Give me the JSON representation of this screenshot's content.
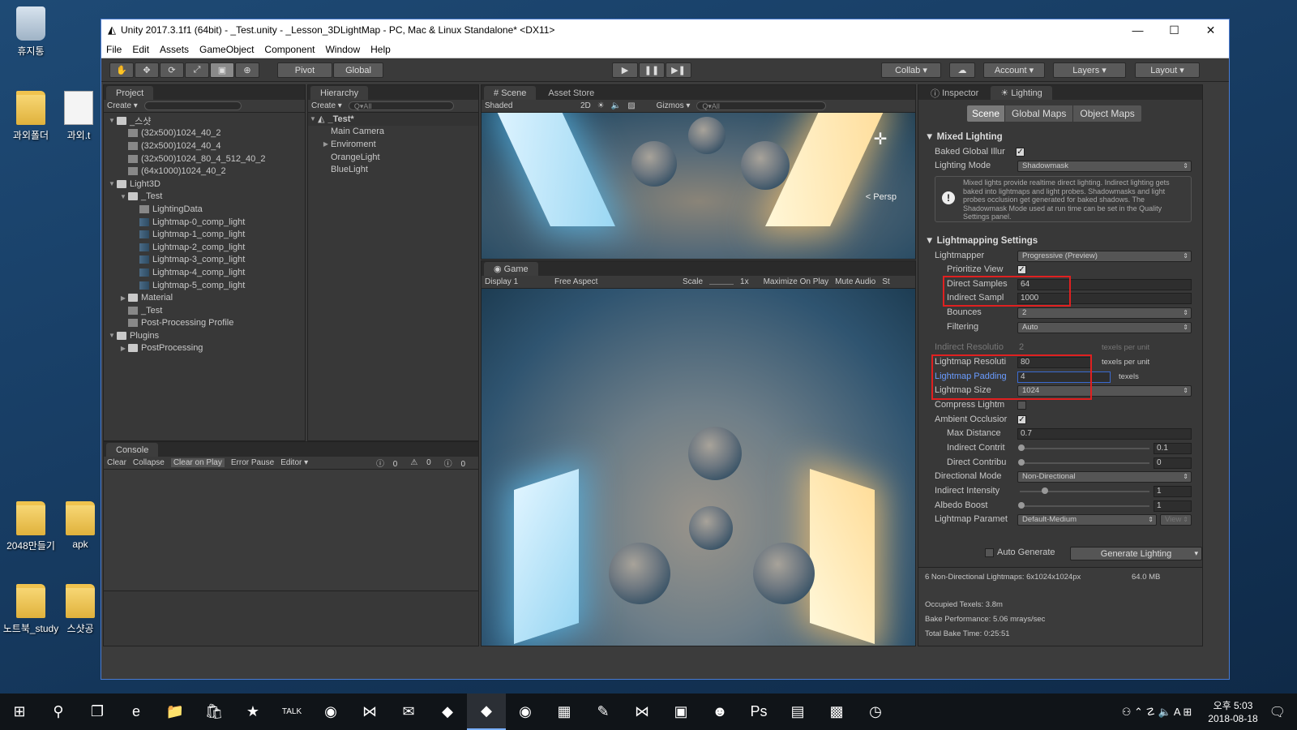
{
  "desktop": {
    "icons": [
      {
        "label": "휴지통",
        "kind": "bin"
      },
      {
        "label": "과외폴더",
        "kind": "folder"
      },
      {
        "label": "과외.t",
        "kind": "doc"
      },
      {
        "label": "2048만들기",
        "kind": "folder"
      },
      {
        "label": "apk",
        "kind": "folder"
      },
      {
        "label": "노트북_study",
        "kind": "folder"
      },
      {
        "label": "스샷공",
        "kind": "folder"
      }
    ]
  },
  "window": {
    "title": "Unity 2017.3.1f1 (64bit) - _Test.unity - _Lesson_3DLightMap - PC, Mac & Linux Standalone* <DX11>",
    "controls": {
      "minimize": "—",
      "maximize": "☐",
      "close": "✕"
    }
  },
  "menu": [
    "File",
    "Edit",
    "Assets",
    "GameObject",
    "Component",
    "Window",
    "Help"
  ],
  "toolbar": {
    "tools": [
      "✋",
      "✥",
      "⟳",
      "⤢",
      "▣",
      "⊕"
    ],
    "pivot": "Pivot",
    "global": "Global",
    "play": "▶",
    "pause": "❚❚",
    "step": "▶❚",
    "collab": "Collab ▾",
    "cloud": "☁",
    "account": "Account",
    "layers": "Layers",
    "layout": "Layout"
  },
  "project": {
    "tab": "Project",
    "create": "Create ▾",
    "items": [
      {
        "label": "_스샷",
        "indent": 0,
        "tri": "▼",
        "icon": "fold"
      },
      {
        "label": "(32x500)1024_40_2",
        "indent": 1,
        "tri": "",
        "icon": "asset"
      },
      {
        "label": "(32x500)1024_40_4",
        "indent": 1,
        "tri": "",
        "icon": "asset"
      },
      {
        "label": "(32x500)1024_80_4_512_40_2",
        "indent": 1,
        "tri": "",
        "icon": "asset"
      },
      {
        "label": "(64x1000)1024_40_2",
        "indent": 1,
        "tri": "",
        "icon": "asset"
      },
      {
        "label": "Light3D",
        "indent": 0,
        "tri": "▼",
        "icon": "fold"
      },
      {
        "label": "_Test",
        "indent": 1,
        "tri": "▼",
        "icon": "fold"
      },
      {
        "label": "LightingData",
        "indent": 2,
        "tri": "",
        "icon": "asset"
      },
      {
        "label": "Lightmap-0_comp_light",
        "indent": 2,
        "tri": "",
        "icon": "lm"
      },
      {
        "label": "Lightmap-1_comp_light",
        "indent": 2,
        "tri": "",
        "icon": "lm"
      },
      {
        "label": "Lightmap-2_comp_light",
        "indent": 2,
        "tri": "",
        "icon": "lm"
      },
      {
        "label": "Lightmap-3_comp_light",
        "indent": 2,
        "tri": "",
        "icon": "lm"
      },
      {
        "label": "Lightmap-4_comp_light",
        "indent": 2,
        "tri": "",
        "icon": "lm"
      },
      {
        "label": "Lightmap-5_comp_light",
        "indent": 2,
        "tri": "",
        "icon": "lm"
      },
      {
        "label": "Material",
        "indent": 1,
        "tri": "▶",
        "icon": "fold"
      },
      {
        "label": "_Test",
        "indent": 1,
        "tri": "",
        "icon": "asset"
      },
      {
        "label": "Post-Processing Profile",
        "indent": 1,
        "tri": "",
        "icon": "asset"
      },
      {
        "label": "Plugins",
        "indent": 0,
        "tri": "▼",
        "icon": "fold"
      },
      {
        "label": "PostProcessing",
        "indent": 1,
        "tri": "▶",
        "icon": "fold"
      }
    ]
  },
  "hierarchy": {
    "tab": "Hierarchy",
    "create": "Create ▾",
    "search": "Q▾All",
    "scene": "_Test*",
    "items": [
      {
        "label": "Main Camera",
        "tri": ""
      },
      {
        "label": "Enviroment",
        "tri": "▶"
      },
      {
        "label": "OrangeLight",
        "tri": ""
      },
      {
        "label": "BlueLight",
        "tri": ""
      }
    ]
  },
  "scene": {
    "tab": "Scene",
    "tab2": "Asset Store",
    "shaded": "Shaded",
    "mode2d": "2D",
    "gizmos": "Gizmos ▾",
    "search": "Q▾All",
    "persp": "< Persp"
  },
  "game": {
    "tab": "Game",
    "display": "Display 1",
    "aspect": "Free Aspect",
    "scale": "Scale",
    "scale_val": "1x",
    "maximize": "Maximize On Play",
    "mute": "Mute Audio",
    "stats": "St"
  },
  "console": {
    "tab": "Console",
    "buttons": [
      "Clear",
      "Collapse",
      "Clear on Play",
      "Error Pause",
      "Editor ▾"
    ],
    "counts": [
      "0",
      "0",
      "0"
    ]
  },
  "inspector": {
    "tab": "Inspector",
    "tab2": "Lighting",
    "subtabs": [
      "Scene",
      "Global Maps",
      "Object Maps"
    ],
    "mixed_title": "Mixed Lighting",
    "baked_gi": "Baked Global Illur",
    "lighting_mode": "Lighting Mode",
    "lighting_mode_val": "Shadowmask",
    "info": "Mixed lights provide realtime direct lighting. Indirect lighting gets baked into lightmaps and light probes. Shadowmasks and light probes occlusion get generated for baked shadows. The Shadowmask Mode used at run time can be set in the Quality Settings panel.",
    "lm_title": "Lightmapping Settings",
    "lightmapper": "Lightmapper",
    "lightmapper_val": "Progressive (Preview)",
    "prioritize": "Prioritize View",
    "direct_samples": "Direct Samples",
    "direct_samples_val": "64",
    "indirect_samples": "Indirect Sampl",
    "indirect_samples_val": "1000",
    "bounces": "Bounces",
    "bounces_val": "2",
    "filtering": "Filtering",
    "filtering_val": "Auto",
    "indirect_res": "Indirect Resolutio",
    "indirect_res_val": "2",
    "texels_per_unit": "texels per unit",
    "lm_res": "Lightmap Resoluti",
    "lm_res_val": "80",
    "lm_padding": "Lightmap Padding",
    "lm_padding_val": "4",
    "texels": "texels",
    "lm_size": "Lightmap Size",
    "lm_size_val": "1024",
    "compress": "Compress Lightm",
    "ao": "Ambient Occlusior",
    "max_dist": "Max Distance",
    "max_dist_val": "0.7",
    "indirect_contrib": "Indirect Contrit",
    "indirect_contrib_val": "0.1",
    "direct_contrib": "Direct Contribu",
    "direct_contrib_val": "0",
    "directional_mode": "Directional Mode",
    "directional_mode_val": "Non-Directional",
    "indirect_intensity": "Indirect Intensity",
    "indirect_intensity_val": "1",
    "albedo_boost": "Albedo Boost",
    "albedo_boost_val": "1",
    "lm_params": "Lightmap Paramet",
    "lm_params_val": "Default-Medium",
    "view": "View",
    "auto_generate": "Auto Generate",
    "generate": "Generate Lighting",
    "stats_line1": "6 Non-Directional Lightmaps: 6x1024x1024px",
    "stats_size": "64.0 MB",
    "occupied": "Occupied Texels: 3.8m",
    "bake_perf": "Bake Performance: 5.06 mrays/sec",
    "bake_time": "Total Bake Time: 0:25:51"
  },
  "taskbar": {
    "icons": [
      "⊞",
      "⚲",
      "❐",
      "e",
      "📁",
      "🛍",
      "★",
      "TALK",
      "◉",
      "⋈",
      "✉",
      "◆",
      "◆",
      "◉",
      "▦",
      "✎",
      "⋈",
      "▣",
      "☻",
      "Ps",
      "▤",
      "▩",
      "◷"
    ],
    "time_ampm": "오후 5:03",
    "date": "2018-08-18",
    "tray": "⚇  ⌃  ☡  🔈  A  ⊞"
  }
}
